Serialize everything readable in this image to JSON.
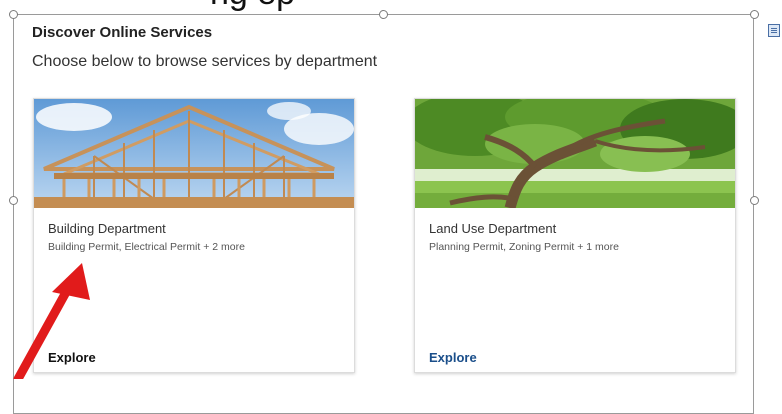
{
  "header_clipped_text": "ng ep",
  "section": {
    "title": "Discover Online Services",
    "subtitle": "Choose below to browse services by department"
  },
  "cards": [
    {
      "name": "Building Department",
      "services": "Building Permit, Electrical Permit + 2 more",
      "cta": "Explore",
      "cta_color": "#111111",
      "image_icon": "house-framing-image"
    },
    {
      "name": "Land Use Department",
      "services": "Planning Permit, Zoning Permit + 1 more",
      "cta": "Explore",
      "cta_color": "#1a4e8a",
      "image_icon": "tree-landscape-image"
    }
  ],
  "colors": {
    "annotation_arrow": "#e11b1b",
    "frame_border": "#9a9a9a"
  }
}
